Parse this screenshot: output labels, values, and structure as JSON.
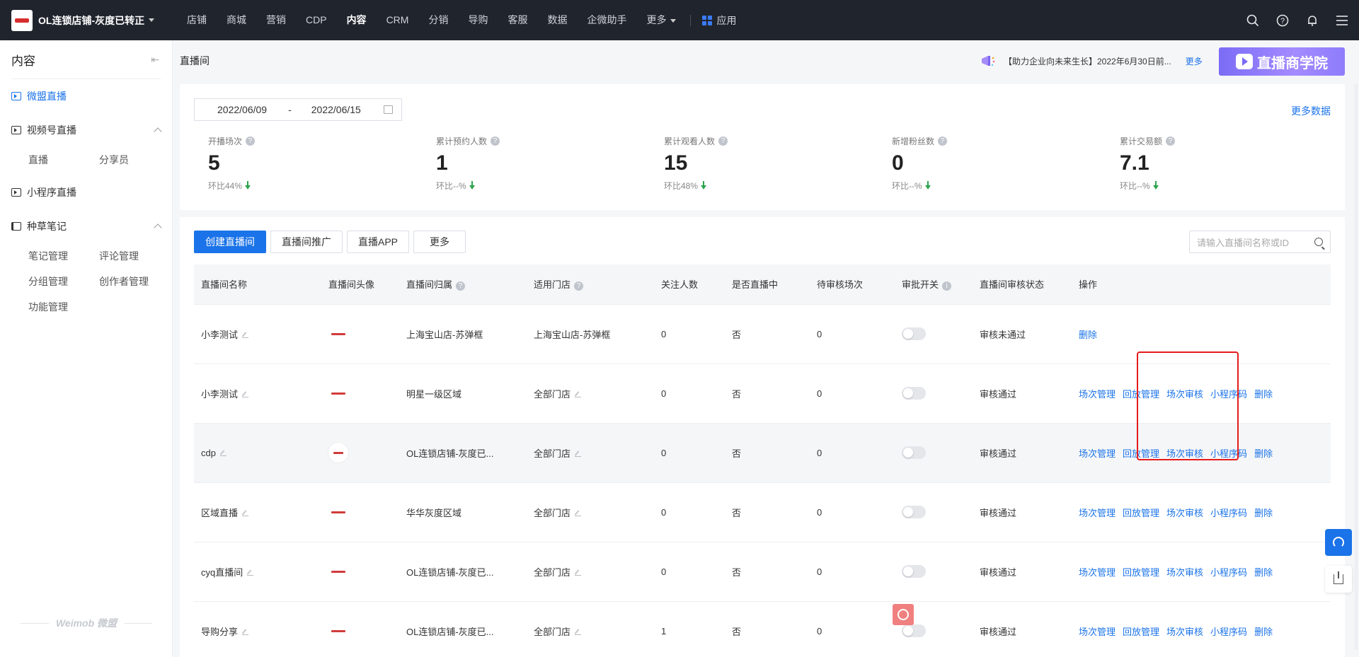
{
  "topbar": {
    "store_name": "OL连锁店铺-灰度已转正",
    "nav": [
      "店铺",
      "商城",
      "营销",
      "CDP",
      "内容",
      "CRM",
      "分销",
      "导购",
      "客服",
      "数据",
      "企微助手",
      "更多"
    ],
    "active_nav": "内容",
    "apps_label": "应用",
    "icons": [
      "search-icon",
      "help-icon",
      "bell-icon",
      "menu-icon"
    ]
  },
  "sidebar": {
    "title": "内容",
    "groups": [
      {
        "label": "微盟直播",
        "active": true,
        "icon": "video-icon",
        "items": []
      },
      {
        "label": "视频号直播",
        "icon": "video-icon",
        "items": [
          "直播",
          "分享员"
        ]
      },
      {
        "label": "小程序直播",
        "icon": "video-icon",
        "items": []
      },
      {
        "label": "种草笔记",
        "icon": "book-icon",
        "items": [
          "笔记管理",
          "评论管理",
          "分组管理",
          "创作者管理",
          "功能管理"
        ]
      }
    ],
    "footer": "Weimob 微盟"
  },
  "page": {
    "title": "直播间",
    "notice": "【助力企业向未来生长】2022年6月30日前...",
    "notice_more": "更多",
    "banner": "直播商学院"
  },
  "stats": {
    "date_start": "2022/06/09",
    "date_sep": "-",
    "date_end": "2022/06/15",
    "more_data": "更多数据",
    "items": [
      {
        "label": "开播场次",
        "value": "5",
        "compare": "环比44%"
      },
      {
        "label": "累计预约人数",
        "value": "1",
        "compare": "环比--%"
      },
      {
        "label": "累计观看人数",
        "value": "15",
        "compare": "环比48%"
      },
      {
        "label": "新增粉丝数",
        "value": "0",
        "compare": "环比--%"
      },
      {
        "label": "累计交易额",
        "value": "7.1",
        "compare": "环比--%"
      }
    ]
  },
  "toolbar": {
    "create": "创建直播间",
    "promote": "直播间推广",
    "app": "直播APP",
    "more": "更多",
    "search_placeholder": "请输入直播间名称或ID"
  },
  "table": {
    "headers": [
      "直播间名称",
      "直播间头像",
      "直播间归属",
      "适用门店",
      "关注人数",
      "是否直播中",
      "待审核场次",
      "审批开关",
      "直播间审核状态",
      "操作"
    ],
    "ops_labels": [
      "场次管理",
      "回放管理",
      "场次审核",
      "小程序码",
      "删除"
    ],
    "rows": [
      {
        "name": "小李测试",
        "belong": "上海宝山店-苏弹框",
        "store": "上海宝山店-苏弹框",
        "follow": "0",
        "live": "否",
        "pending": "0",
        "status": "审核未通过",
        "ops": [
          "删除"
        ]
      },
      {
        "name": "小李测试",
        "belong": "明星一级区域",
        "store": "全部门店",
        "follow": "0",
        "live": "否",
        "pending": "0",
        "status": "审核通过",
        "ops": [
          "场次管理",
          "回放管理",
          "场次审核",
          "小程序码",
          "删除"
        ]
      },
      {
        "name": "cdp",
        "belong": "OL连锁店铺-灰度已...",
        "store": "全部门店",
        "follow": "0",
        "live": "否",
        "pending": "0",
        "status": "审核通过",
        "ops": [
          "场次管理",
          "回放管理",
          "场次审核",
          "小程序码",
          "删除"
        ]
      },
      {
        "name": "区域直播",
        "belong": "华华灰度区域",
        "store": "全部门店",
        "follow": "0",
        "live": "否",
        "pending": "0",
        "status": "审核通过",
        "ops": [
          "场次管理",
          "回放管理",
          "场次审核",
          "小程序码",
          "删除"
        ]
      },
      {
        "name": "cyq直播间",
        "belong": "OL连锁店铺-灰度已...",
        "store": "全部门店",
        "follow": "0",
        "live": "否",
        "pending": "0",
        "status": "审核通过",
        "ops": [
          "场次管理",
          "回放管理",
          "场次审核",
          "小程序码",
          "删除"
        ]
      },
      {
        "name": "导购分享",
        "belong": "OL连锁店铺-灰度已...",
        "store": "全部门店",
        "follow": "1",
        "live": "否",
        "pending": "0",
        "status": "审核通过",
        "ops": [
          "场次管理",
          "回放管理",
          "场次审核",
          "小程序码",
          "删除"
        ]
      }
    ]
  },
  "colors": {
    "accent": "#1a73e8",
    "ok": "#2ba245",
    "fail": "#e34d4d",
    "highlight_box": "#e51b1b"
  }
}
